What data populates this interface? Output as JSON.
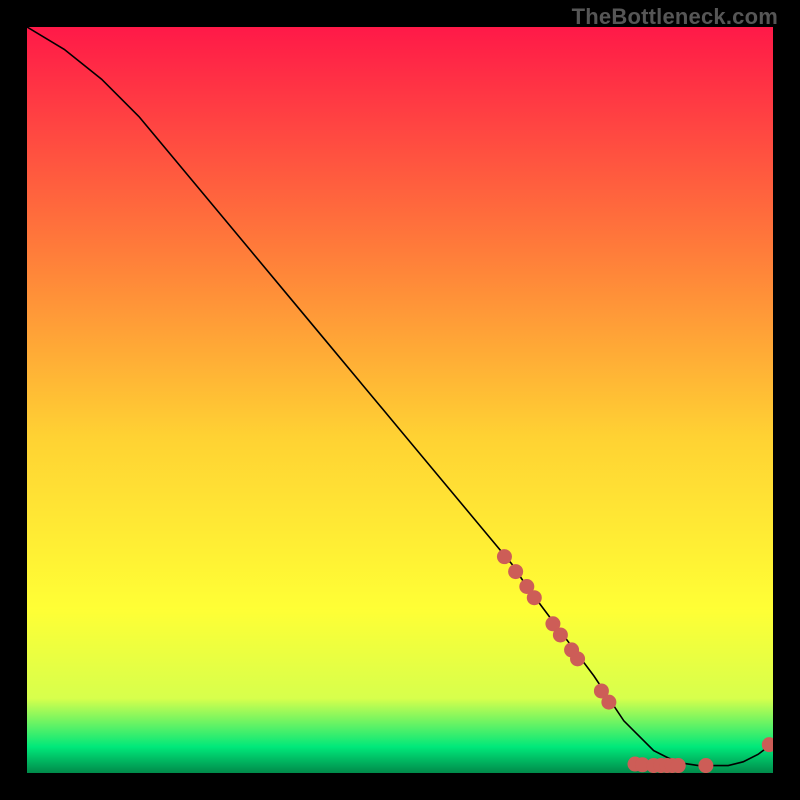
{
  "watermark": "TheBottleneck.com",
  "colors": {
    "gradient_top": "#ff1948",
    "gradient_mid_upper": "#ff7c3a",
    "gradient_mid": "#ffd233",
    "gradient_mid_lower": "#ffff35",
    "gradient_near_bottom": "#d7ff4c",
    "gradient_green": "#00e87a",
    "gradient_bottom": "#008a4a",
    "line": "#000000",
    "marker": "#cd5d57",
    "background": "#000000"
  },
  "chart_data": {
    "type": "line",
    "title": "",
    "xlabel": "",
    "ylabel": "",
    "xlim": [
      0,
      100
    ],
    "ylim": [
      0,
      100
    ],
    "series": [
      {
        "name": "curve",
        "x": [
          0,
          5,
          10,
          15,
          20,
          25,
          30,
          35,
          40,
          45,
          50,
          55,
          60,
          65,
          67,
          70,
          73,
          76,
          78,
          80,
          82,
          84,
          86,
          88,
          90,
          92,
          94,
          96,
          98,
          100
        ],
        "y": [
          100,
          97,
          93,
          88,
          82,
          76,
          70,
          64,
          58,
          52,
          46,
          40,
          34,
          28,
          25,
          21,
          17,
          13,
          10,
          7,
          5,
          3,
          2,
          1.3,
          1,
          1,
          1,
          1.5,
          2.5,
          4
        ]
      }
    ],
    "markers": [
      {
        "x": 64.0,
        "y": 29.0
      },
      {
        "x": 65.5,
        "y": 27.0
      },
      {
        "x": 67.0,
        "y": 25.0
      },
      {
        "x": 68.0,
        "y": 23.5
      },
      {
        "x": 70.5,
        "y": 20.0
      },
      {
        "x": 71.5,
        "y": 18.5
      },
      {
        "x": 73.0,
        "y": 16.5
      },
      {
        "x": 73.8,
        "y": 15.3
      },
      {
        "x": 77.0,
        "y": 11.0
      },
      {
        "x": 78.0,
        "y": 9.5
      },
      {
        "x": 81.5,
        "y": 1.2
      },
      {
        "x": 82.5,
        "y": 1.1
      },
      {
        "x": 84.0,
        "y": 1.0
      },
      {
        "x": 85.0,
        "y": 1.0
      },
      {
        "x": 85.8,
        "y": 1.0
      },
      {
        "x": 86.5,
        "y": 1.0
      },
      {
        "x": 87.3,
        "y": 1.0
      },
      {
        "x": 91.0,
        "y": 1.0
      },
      {
        "x": 99.5,
        "y": 3.8
      }
    ],
    "gradient_stops": [
      {
        "offset": 0,
        "key": "gradient_top"
      },
      {
        "offset": 0.3,
        "key": "gradient_mid_upper"
      },
      {
        "offset": 0.55,
        "key": "gradient_mid"
      },
      {
        "offset": 0.78,
        "key": "gradient_mid_lower"
      },
      {
        "offset": 0.9,
        "key": "gradient_near_bottom"
      },
      {
        "offset": 0.965,
        "key": "gradient_green"
      },
      {
        "offset": 1.0,
        "key": "gradient_bottom"
      }
    ]
  }
}
